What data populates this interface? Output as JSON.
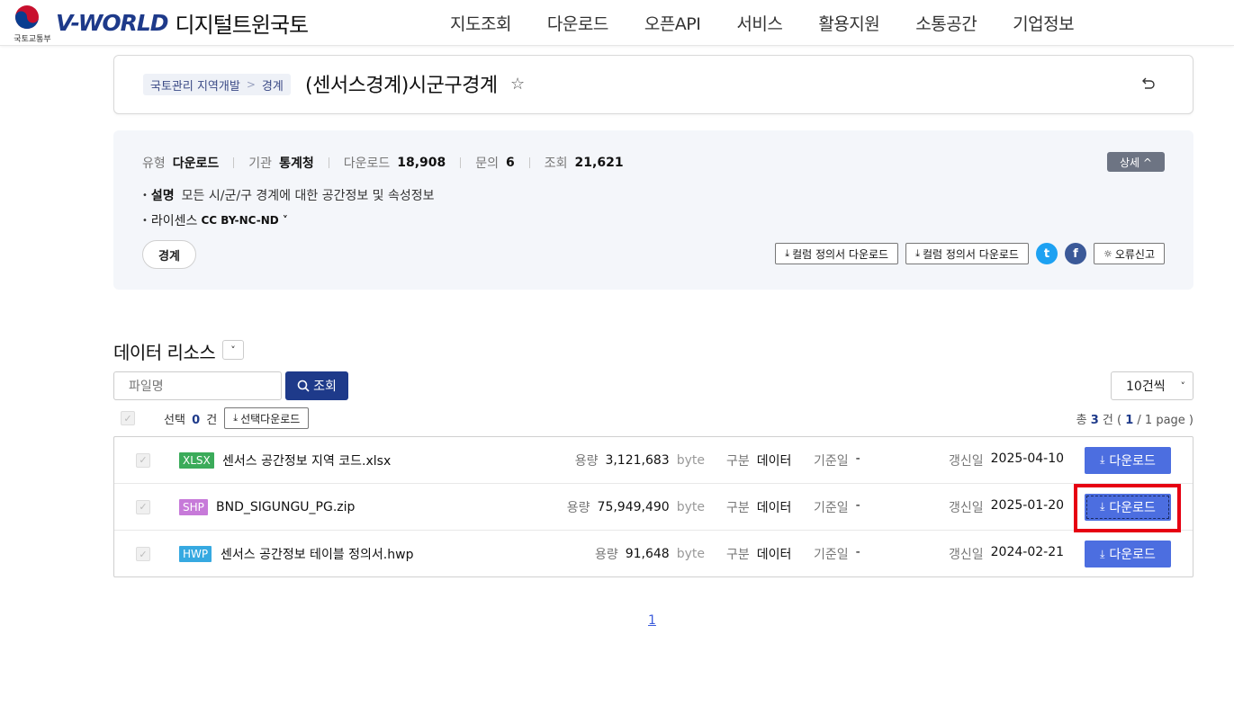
{
  "header": {
    "ministry_label": "국토교통부",
    "brand_logo": "V-WORLD",
    "brand_sub": "디지털트윈국토",
    "nav": [
      "지도조회",
      "다운로드",
      "오픈API",
      "서비스",
      "활용지원",
      "소통공간",
      "기업정보"
    ]
  },
  "title_card": {
    "crumbs": [
      "국토관리 지역개발",
      "경계"
    ],
    "title": "(센서스경계)시군구경계",
    "star_icon": "☆"
  },
  "info": {
    "meta": [
      {
        "key": "유형",
        "value": "다운로드"
      },
      {
        "key": "기관",
        "value": "통계청"
      },
      {
        "key": "다운로드",
        "value": "18,908"
      },
      {
        "key": "문의",
        "value": "6"
      },
      {
        "key": "조회",
        "value": "21,621"
      }
    ],
    "detail_label": "상세 ^",
    "desc_key": "설명",
    "desc_value": "모든 시/군/구 경계에 대한 공간정보 및 속성정보",
    "license_key": "라이센스",
    "license_value": "CC BY-NC-ND ˅",
    "tag": "경계",
    "column_def_btn_1": "컬럼 정의서 다운로드",
    "column_def_btn_2": "컬럼 정의서 다운로드",
    "twitter_icon": "t",
    "facebook_icon": "f",
    "report_btn": "오류신고"
  },
  "resources": {
    "title": "데이터 리소스",
    "toggle": "˅",
    "search_placeholder": "파일명",
    "search_btn": "조회",
    "per_page": "10건씩",
    "select_label_prefix": "선택",
    "select_count": "0",
    "select_label_suffix": "건",
    "select_download_btn": "선택다운로드",
    "total_prefix": "총",
    "total_count": "3",
    "total_suffix": "건 (",
    "total_page": "1",
    "total_page_suffix": "/ 1 page )",
    "labels": {
      "size": "용량",
      "unit": "byte",
      "kind": "구분",
      "base": "기준일",
      "updated": "갱신일",
      "download": "다운로드"
    },
    "files": [
      {
        "ext": "XLSX",
        "ext_color": "#3bab5a",
        "name": "센서스 공간정보 지역 코드.xlsx",
        "size": "3,121,683",
        "kind": "데이터",
        "base": "-",
        "updated": "2025-04-10"
      },
      {
        "ext": "SHP",
        "ext_color": "#c77ad9",
        "name": "BND_SIGUNGU_PG.zip",
        "size": "75,949,490",
        "kind": "데이터",
        "base": "-",
        "updated": "2025-01-20"
      },
      {
        "ext": "HWP",
        "ext_color": "#36a9e1",
        "name": "센서스 공간정보 테이블 정의서.hwp",
        "size": "91,648",
        "kind": "데이터",
        "base": "-",
        "updated": "2024-02-21"
      }
    ]
  },
  "pager": {
    "current": "1"
  }
}
